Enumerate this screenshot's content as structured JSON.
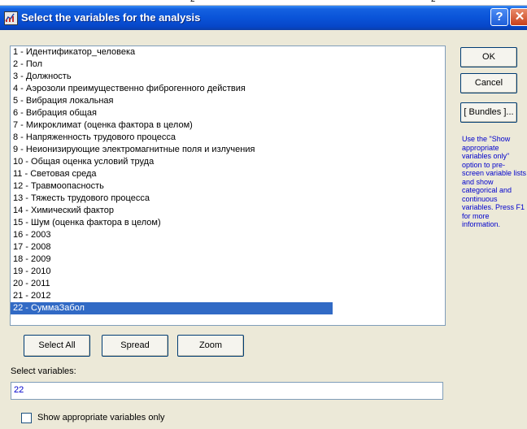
{
  "window": {
    "title": "Select the variables for the analysis",
    "help_glyph": "?",
    "close_glyph": "✕",
    "top_marks": [
      "2",
      "2"
    ]
  },
  "variables": [
    "1 - Идентификатор_человека",
    "2 - Пол",
    "3 - Должность",
    "4 - Аэрозоли преимущественно фиброгенного действия",
    "5 - Вибрация локальная",
    "6 - Вибрация общая",
    "7 - Микроклимат (оценка фактора в целом)",
    "8 - Напряженность трудового процесса",
    "9 - Неионизирующие электромагнитные поля и излучения",
    "10 - Общая оценка условий труда",
    "11 - Световая среда",
    "12 - Травмоопасность",
    "13 - Тяжесть трудового процесса",
    "14 - Химический фактор",
    "15 - Шум (оценка фактора в целом)",
    "16 - 2003",
    "17 - 2008",
    "18 - 2009",
    "19 - 2010",
    "20 - 2011",
    "21 - 2012",
    "22 - СуммаЗабол"
  ],
  "selected_index": 21,
  "buttons": {
    "ok": "OK",
    "cancel": "Cancel",
    "bundles": "[ Bundles ]...",
    "select_all": "Select All",
    "spread": "Spread",
    "zoom": "Zoom"
  },
  "help_text": "Use the \"Show appropriate variables only\" option to pre-screen variable lists and show categorical and continuous variables. Press F1 for more information.",
  "select_variables": {
    "label": "Select variables:",
    "value": "22"
  },
  "show_appropriate": {
    "label": "Show appropriate variables only",
    "checked": false
  },
  "colors": {
    "title_bar": "#0a53d8",
    "selection": "#316ac5",
    "help_text": "#0000cc",
    "dialog_bg": "#ece9d8"
  },
  "icons": {
    "app": "statistica-app-icon",
    "help": "help-icon",
    "close": "close-icon"
  }
}
